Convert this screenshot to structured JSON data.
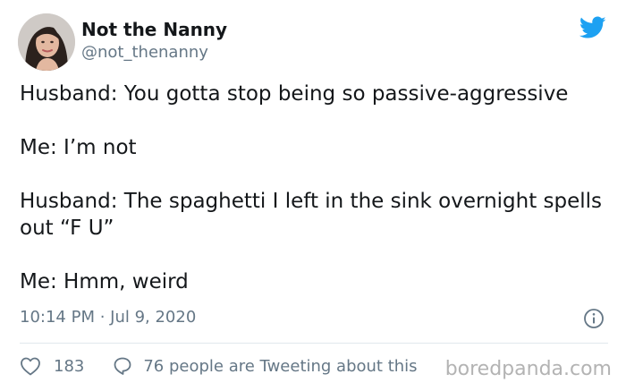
{
  "author": {
    "display_name": "Not the Nanny",
    "handle": "@not_thenanny"
  },
  "icons": {
    "bird": "twitter-bird-icon",
    "info": "info-icon",
    "like": "heart-outline-icon",
    "reply": "speech-bubble-icon"
  },
  "colors": {
    "brand": "#1da1f2",
    "text": "#14171a",
    "muted": "#657786",
    "divider": "#e1e8ed",
    "watermark": "#b3b3b3"
  },
  "tweet": {
    "lines": [
      "Husband: You gotta stop being so passive-aggressive",
      "Me: I’m not",
      "Husband: The spaghetti I left in the sink overnight spells out “F U”",
      "Me: Hmm, weird"
    ],
    "timestamp": "10:14 PM · Jul 9, 2020"
  },
  "stats": {
    "likes": "183",
    "conversation": "76 people are Tweeting about this"
  },
  "watermark": "boredpanda.com"
}
